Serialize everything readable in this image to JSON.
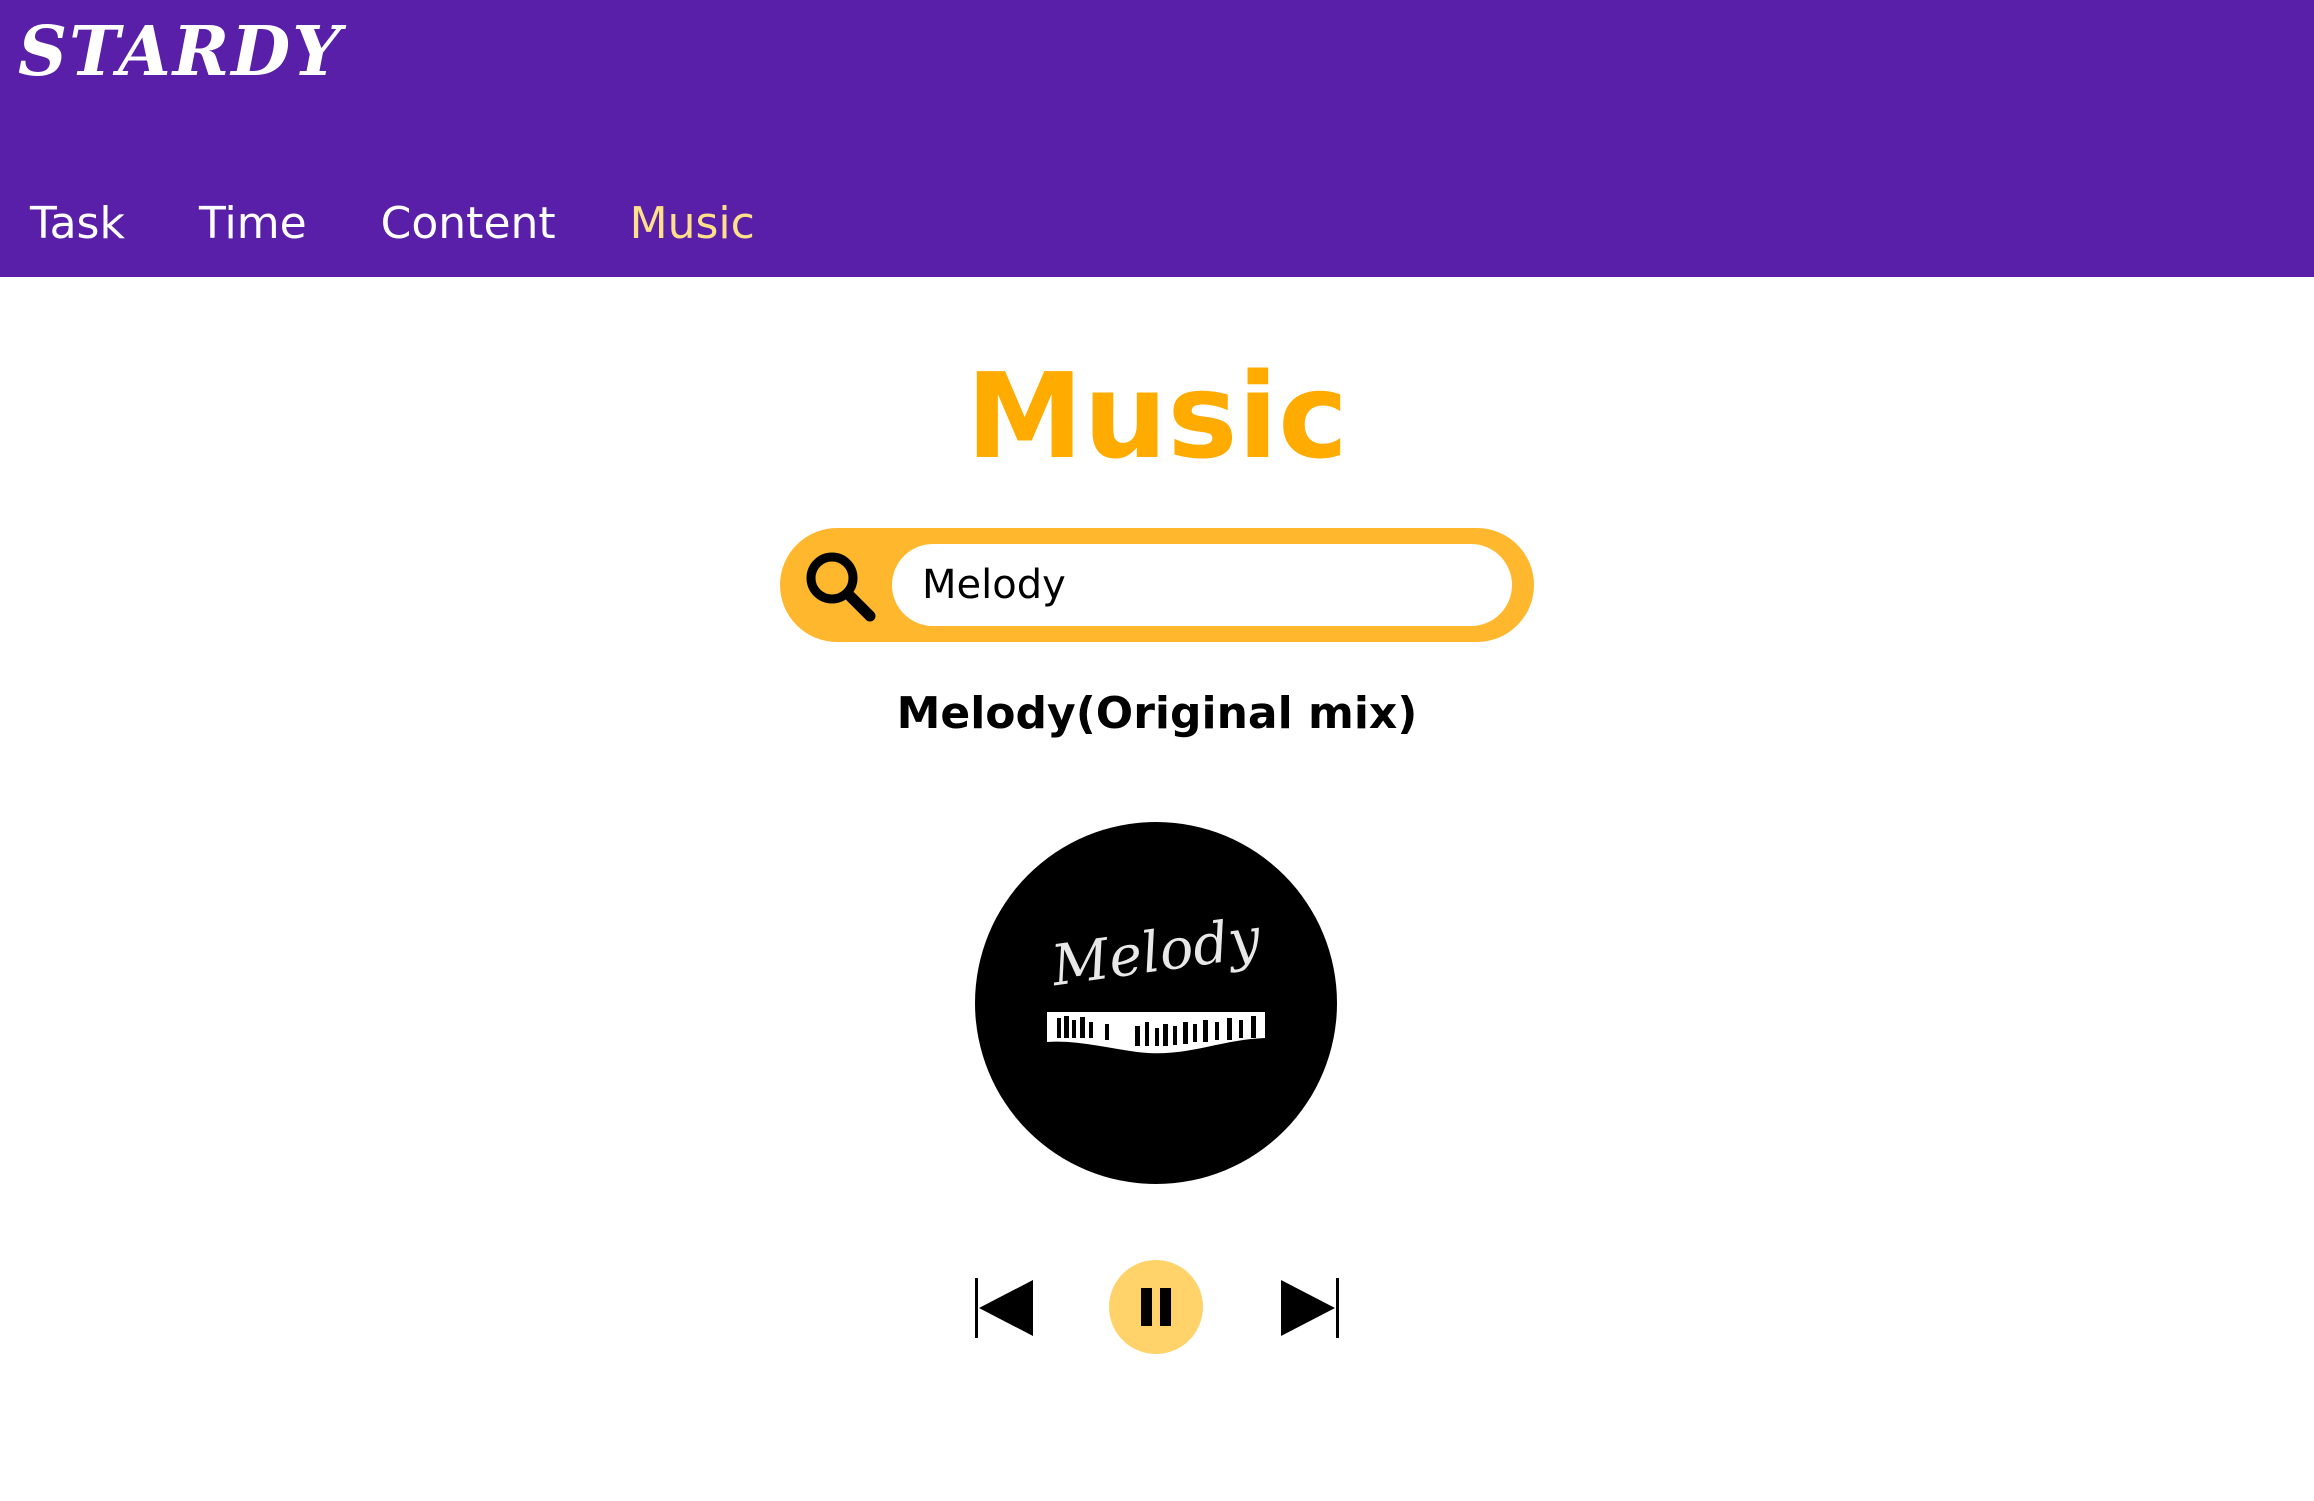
{
  "app": {
    "logo": "STARDY"
  },
  "nav": {
    "items": [
      {
        "label": "Task"
      },
      {
        "label": "Time"
      },
      {
        "label": "Content"
      },
      {
        "label": "Music"
      }
    ],
    "active": "Music"
  },
  "page": {
    "title": "Music"
  },
  "search": {
    "value": "Melody",
    "icon": "search-icon"
  },
  "track": {
    "title": "Melody(Original mix)",
    "cover_text": "Melody"
  },
  "controls": {
    "previous_icon": "skip-previous-icon",
    "pause_icon": "pause-icon",
    "next_icon": "skip-next-icon"
  },
  "colors": {
    "header": "#5a1fa8",
    "accent": "#ffab00",
    "search_bg": "#ffb82e",
    "active_nav": "#ffe08a",
    "play_button": "#ffd36a"
  }
}
